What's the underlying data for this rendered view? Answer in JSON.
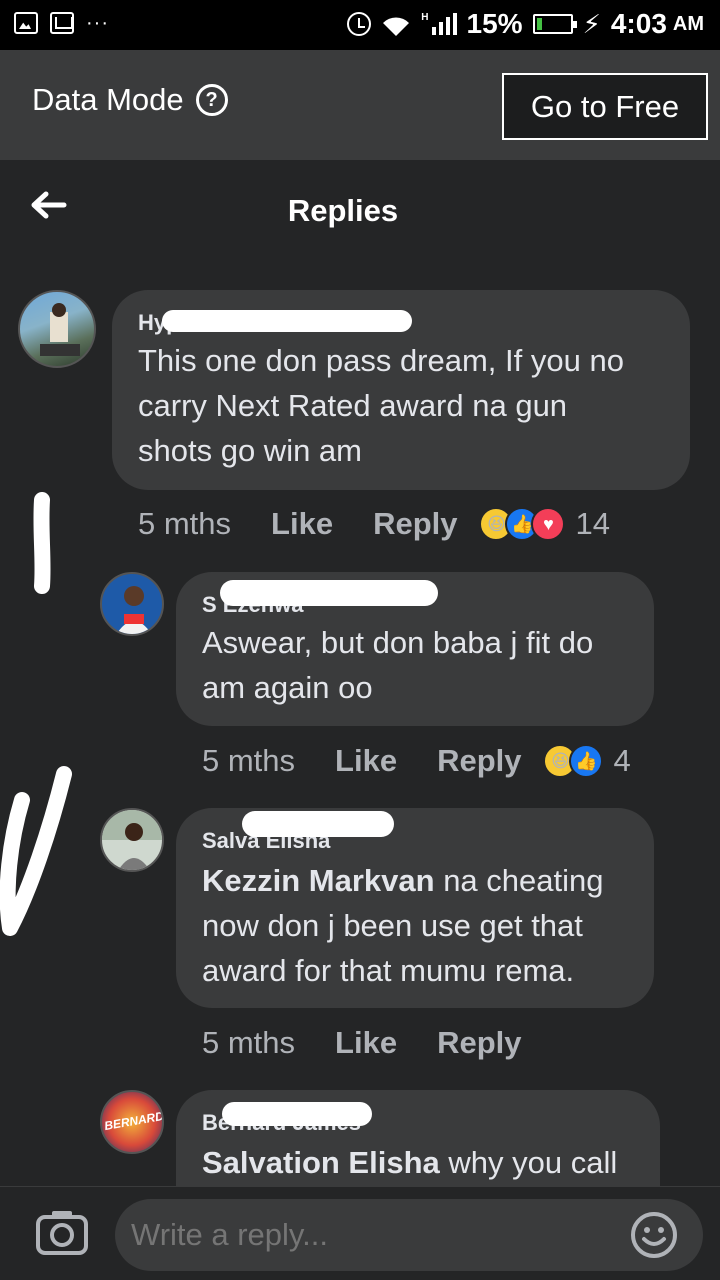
{
  "status_bar": {
    "battery": "15%",
    "battery_level": 0.15,
    "time": "4:03",
    "ampm": "AM",
    "network": "H"
  },
  "data_mode": {
    "label": "Data Mode",
    "button": "Go to Free"
  },
  "header": {
    "title": "Replies"
  },
  "comments": [
    {
      "name": "Hype Gu",
      "lines": [
        "This one don pass dream, If you no",
        "carry Next Rated award na gun",
        "shots go win am"
      ],
      "time": "5 mths",
      "like": "Like",
      "reply": "Reply",
      "reactions": [
        "haha",
        "like",
        "love"
      ],
      "reaction_count": "14"
    },
    {
      "name": "S Ezenwa",
      "lines": [
        "Aswear, but don baba j fit do",
        "am again oo"
      ],
      "time": "5 mths",
      "like": "Like",
      "reply": "Reply",
      "reactions": [
        "haha",
        "like"
      ],
      "reaction_count": "4"
    },
    {
      "name": "Salva Elisha",
      "mention": "Kezzin Markvan",
      "rest": " na cheating",
      "lines": [
        "now don j been use get that",
        "award for that mumu rema."
      ],
      "time": "5 mths",
      "like": "Like",
      "reply": "Reply"
    },
    {
      "name": "Bernard James",
      "avatar_text": "BERNARD",
      "mention": "Salvation Elisha",
      "rest": " why you call"
    }
  ],
  "composer": {
    "placeholder": "Write a reply..."
  }
}
